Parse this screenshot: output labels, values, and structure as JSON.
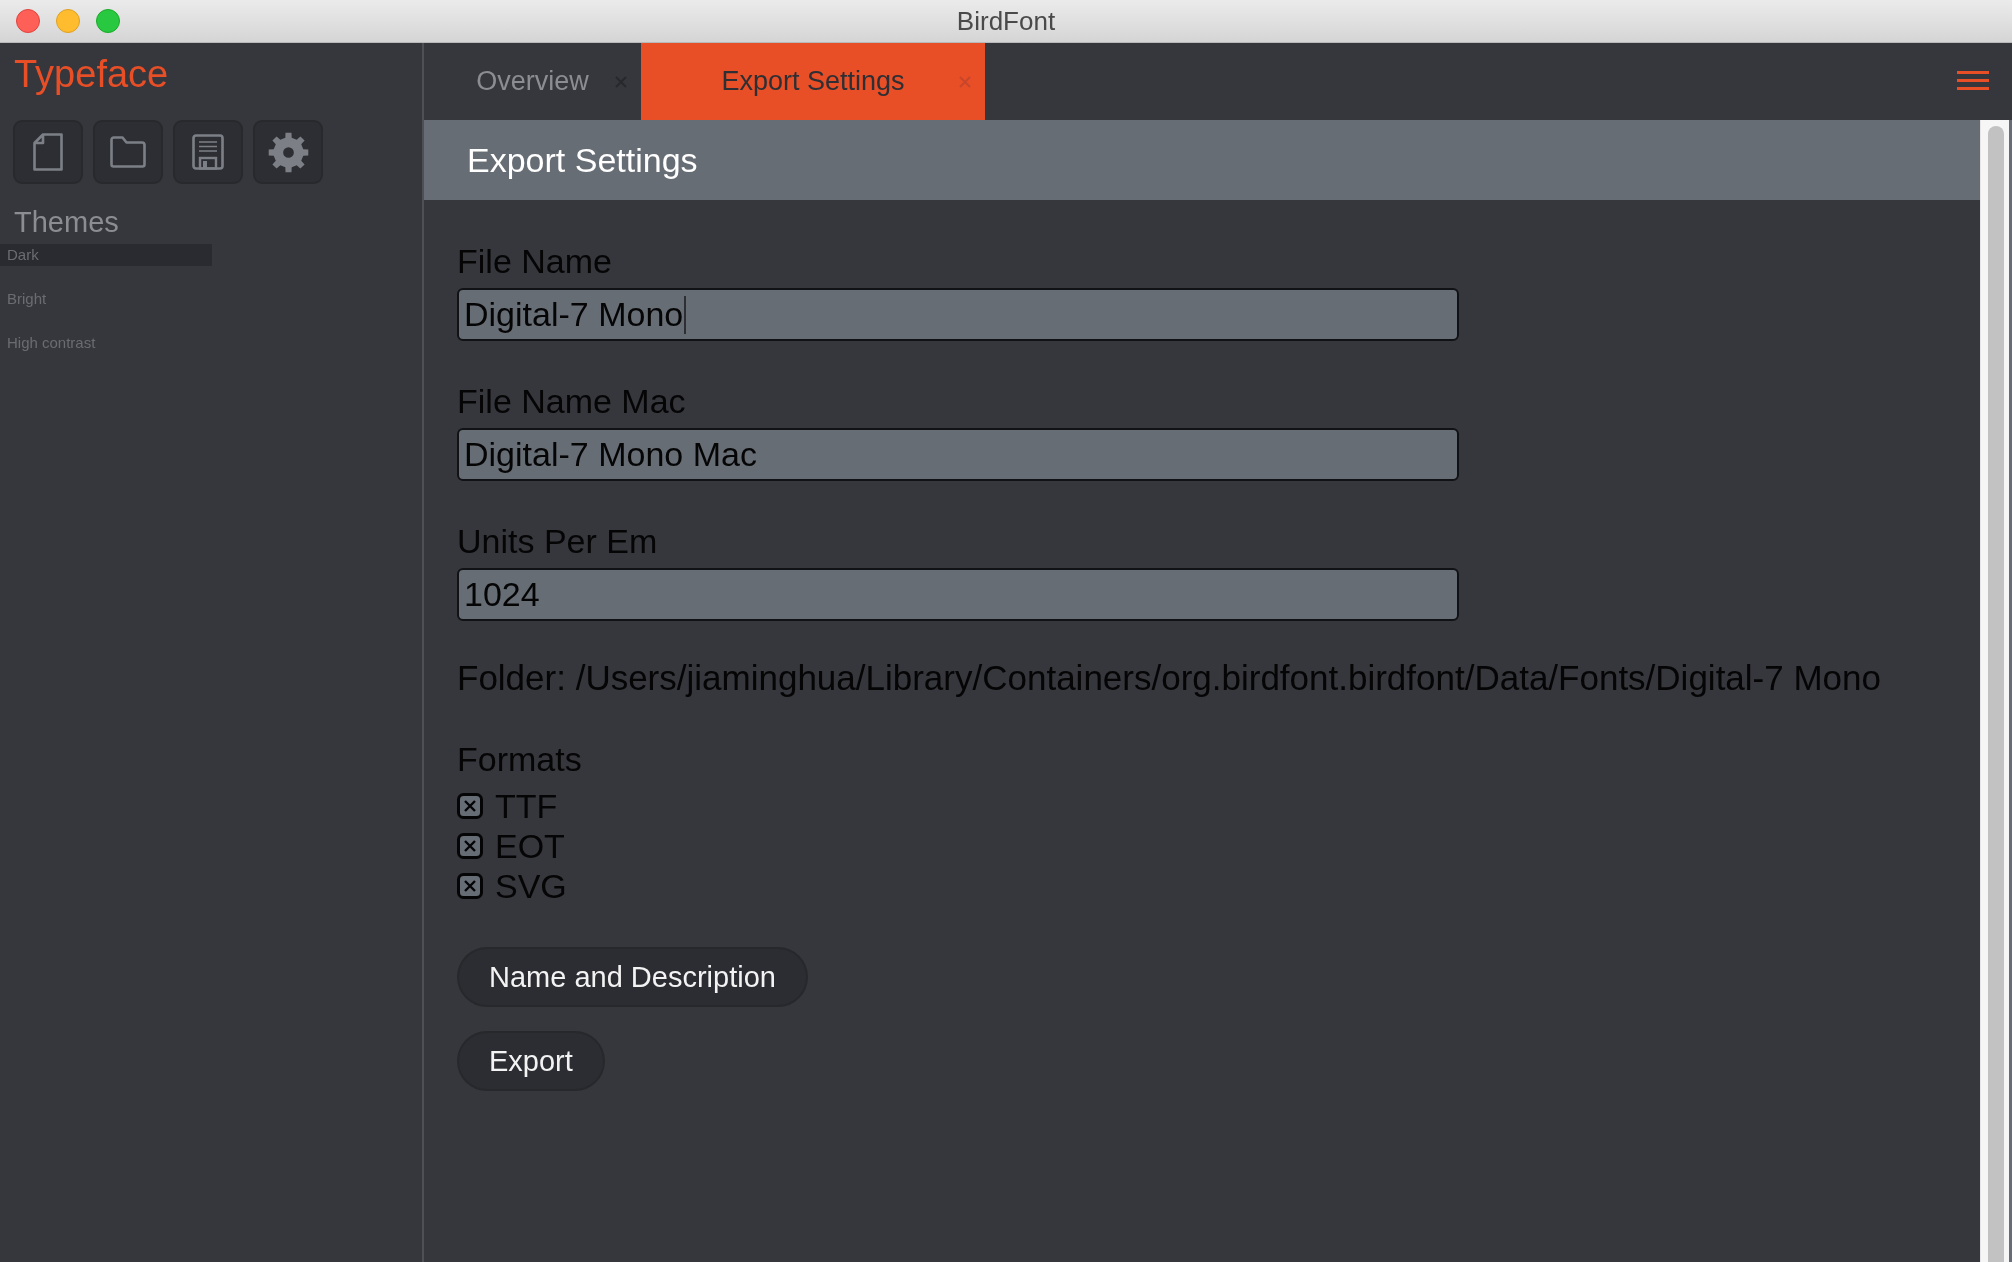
{
  "window": {
    "title": "BirdFont"
  },
  "sidebar": {
    "title": "Typeface",
    "themes": {
      "heading": "Themes",
      "items": [
        {
          "label": "Dark",
          "selected": true
        },
        {
          "label": "Bright",
          "selected": false
        },
        {
          "label": "High contrast",
          "selected": false
        }
      ]
    }
  },
  "tabs": [
    {
      "label": "Overview",
      "selected": false
    },
    {
      "label": "Export Settings",
      "selected": true
    }
  ],
  "page": {
    "heading": "Export Settings",
    "fields": [
      {
        "label": "File Name",
        "value": "Digital-7 Mono",
        "focused": true
      },
      {
        "label": "File Name Mac",
        "value": "Digital-7 Mono Mac",
        "focused": false
      },
      {
        "label": "Units Per Em",
        "value": "1024",
        "focused": false
      }
    ],
    "folder": "Folder: /Users/jiaminghua/Library/Containers/org.birdfont.birdfont/Data/Fonts/Digital-7 Mono",
    "formats": {
      "heading": "Formats",
      "items": [
        {
          "label": "TTF",
          "checked": true
        },
        {
          "label": "EOT",
          "checked": true
        },
        {
          "label": "SVG",
          "checked": true
        }
      ]
    },
    "buttons": [
      "Name and Description",
      "Export"
    ]
  }
}
